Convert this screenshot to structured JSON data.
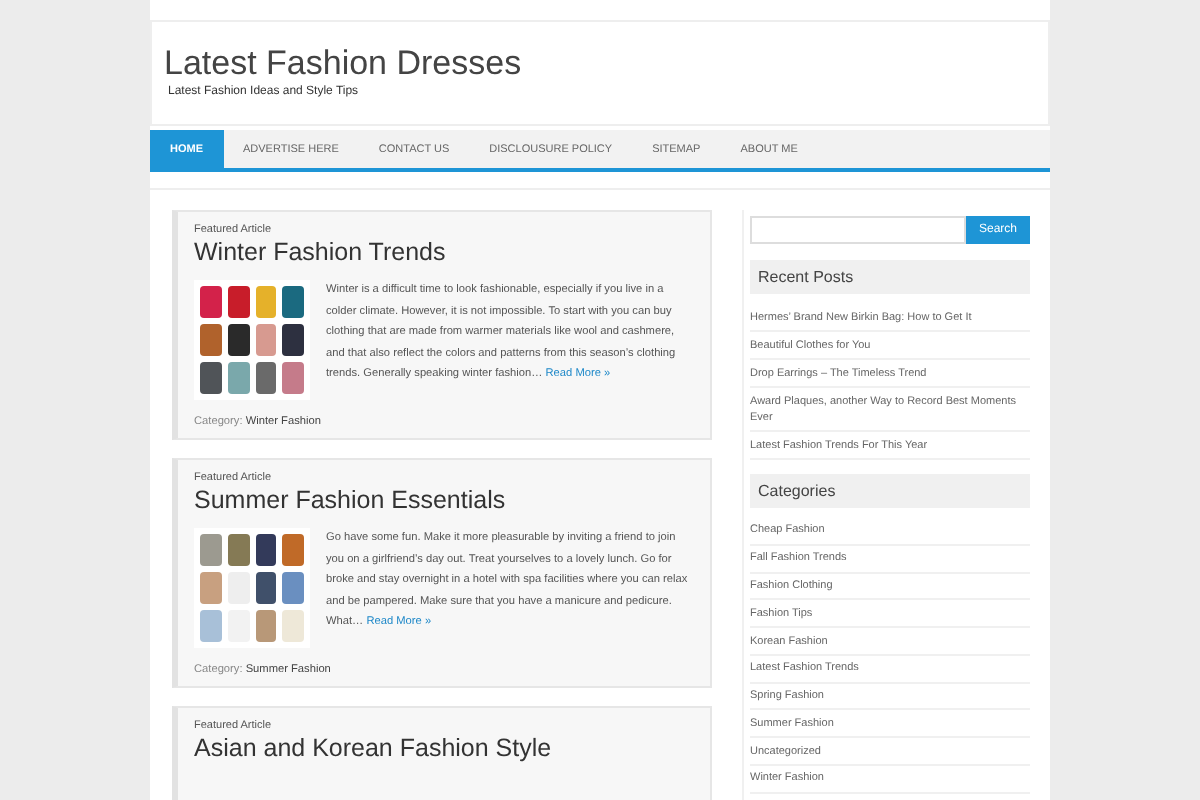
{
  "site": {
    "title": "Latest Fashion Dresses",
    "tagline": "Latest Fashion Ideas and Style Tips"
  },
  "nav": [
    {
      "label": "HOME",
      "selected": true
    },
    {
      "label": "ADVERTISE HERE",
      "selected": false
    },
    {
      "label": "CONTACT US",
      "selected": false
    },
    {
      "label": "DISCLOUSURE POLICY",
      "selected": false
    },
    {
      "label": "SITEMAP",
      "selected": false
    },
    {
      "label": "ABOUT ME",
      "selected": false
    }
  ],
  "articles": [
    {
      "kicker": "Featured Article",
      "title": "Winter Fashion Trends",
      "excerpt": "Winter is a difficult time to look fashionable, especially if you live in a colder climate. However, it is not impossible. To start with you can buy clothing that are made from warmer materials like wool and cashmere, and that also reflect the colors and patterns from this season’s clothing trends. Generally speaking winter fashion…",
      "read_more": "Read More »",
      "category_label": "Category:",
      "category": "Winter Fashion"
    },
    {
      "kicker": "Featured Article",
      "title": "Summer Fashion Essentials",
      "excerpt": "Go have some fun. Make it more pleasurable by inviting a friend to join you on a girlfriend’s day out. Treat yourselves to a lovely lunch. Go for broke and stay overnight in a hotel with spa facilities where you can relax and be pampered. Make sure that you have a manicure and pedicure. What…",
      "read_more": "Read More »",
      "category_label": "Category:",
      "category": "Summer Fashion"
    },
    {
      "kicker": "Featured Article",
      "title": "Asian and Korean Fashion Style"
    }
  ],
  "sidebar": {
    "search_button": "Search",
    "recent_title": "Recent Posts",
    "recent": [
      "Hermes’ Brand New Birkin Bag: How to Get It",
      "Beautiful Clothes for You",
      "Drop Earrings – The Timeless Trend",
      "Award Plaques, another Way to Record Best Moments Ever",
      "Latest Fashion Trends For This Year"
    ],
    "categories_title": "Categories",
    "categories": [
      "Cheap Fashion",
      "Fall Fashion Trends",
      "Fashion Clothing",
      "Fashion Tips",
      "Korean Fashion",
      "Latest Fashion Trends",
      "Spring Fashion",
      "Summer Fashion",
      "Uncategorized",
      "Winter Fashion"
    ]
  }
}
